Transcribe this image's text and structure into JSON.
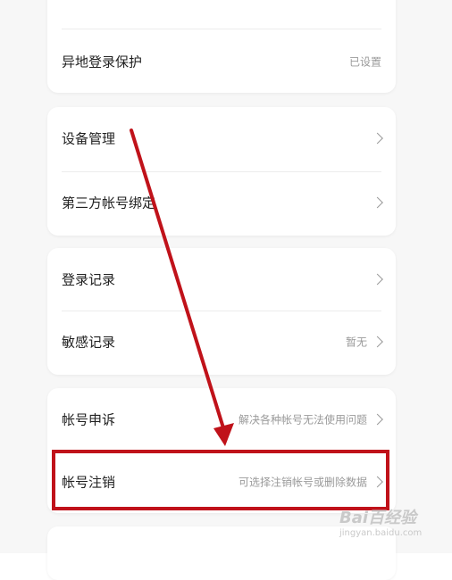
{
  "sections": [
    {
      "rows": [
        {
          "label": "",
          "value": ""
        },
        {
          "label": "异地登录保护",
          "value": "已设置"
        }
      ]
    },
    {
      "rows": [
        {
          "label": "设备管理",
          "value": ""
        },
        {
          "label": "第三方帐号绑定",
          "value": ""
        }
      ]
    },
    {
      "rows": [
        {
          "label": "登录记录",
          "value": ""
        },
        {
          "label": "敏感记录",
          "value": "暂无"
        }
      ]
    },
    {
      "rows": [
        {
          "label": "帐号申诉",
          "value": "解决各种帐号无法使用问题"
        },
        {
          "label": "帐号注销",
          "value": "可选择注销帐号或删除数据"
        }
      ]
    }
  ],
  "annotation": {
    "arrow_color": "#c0121a",
    "highlight_color": "#c0121a"
  },
  "watermark": {
    "brand": "Bai百经验",
    "url": "jingyan.baidu.com"
  }
}
